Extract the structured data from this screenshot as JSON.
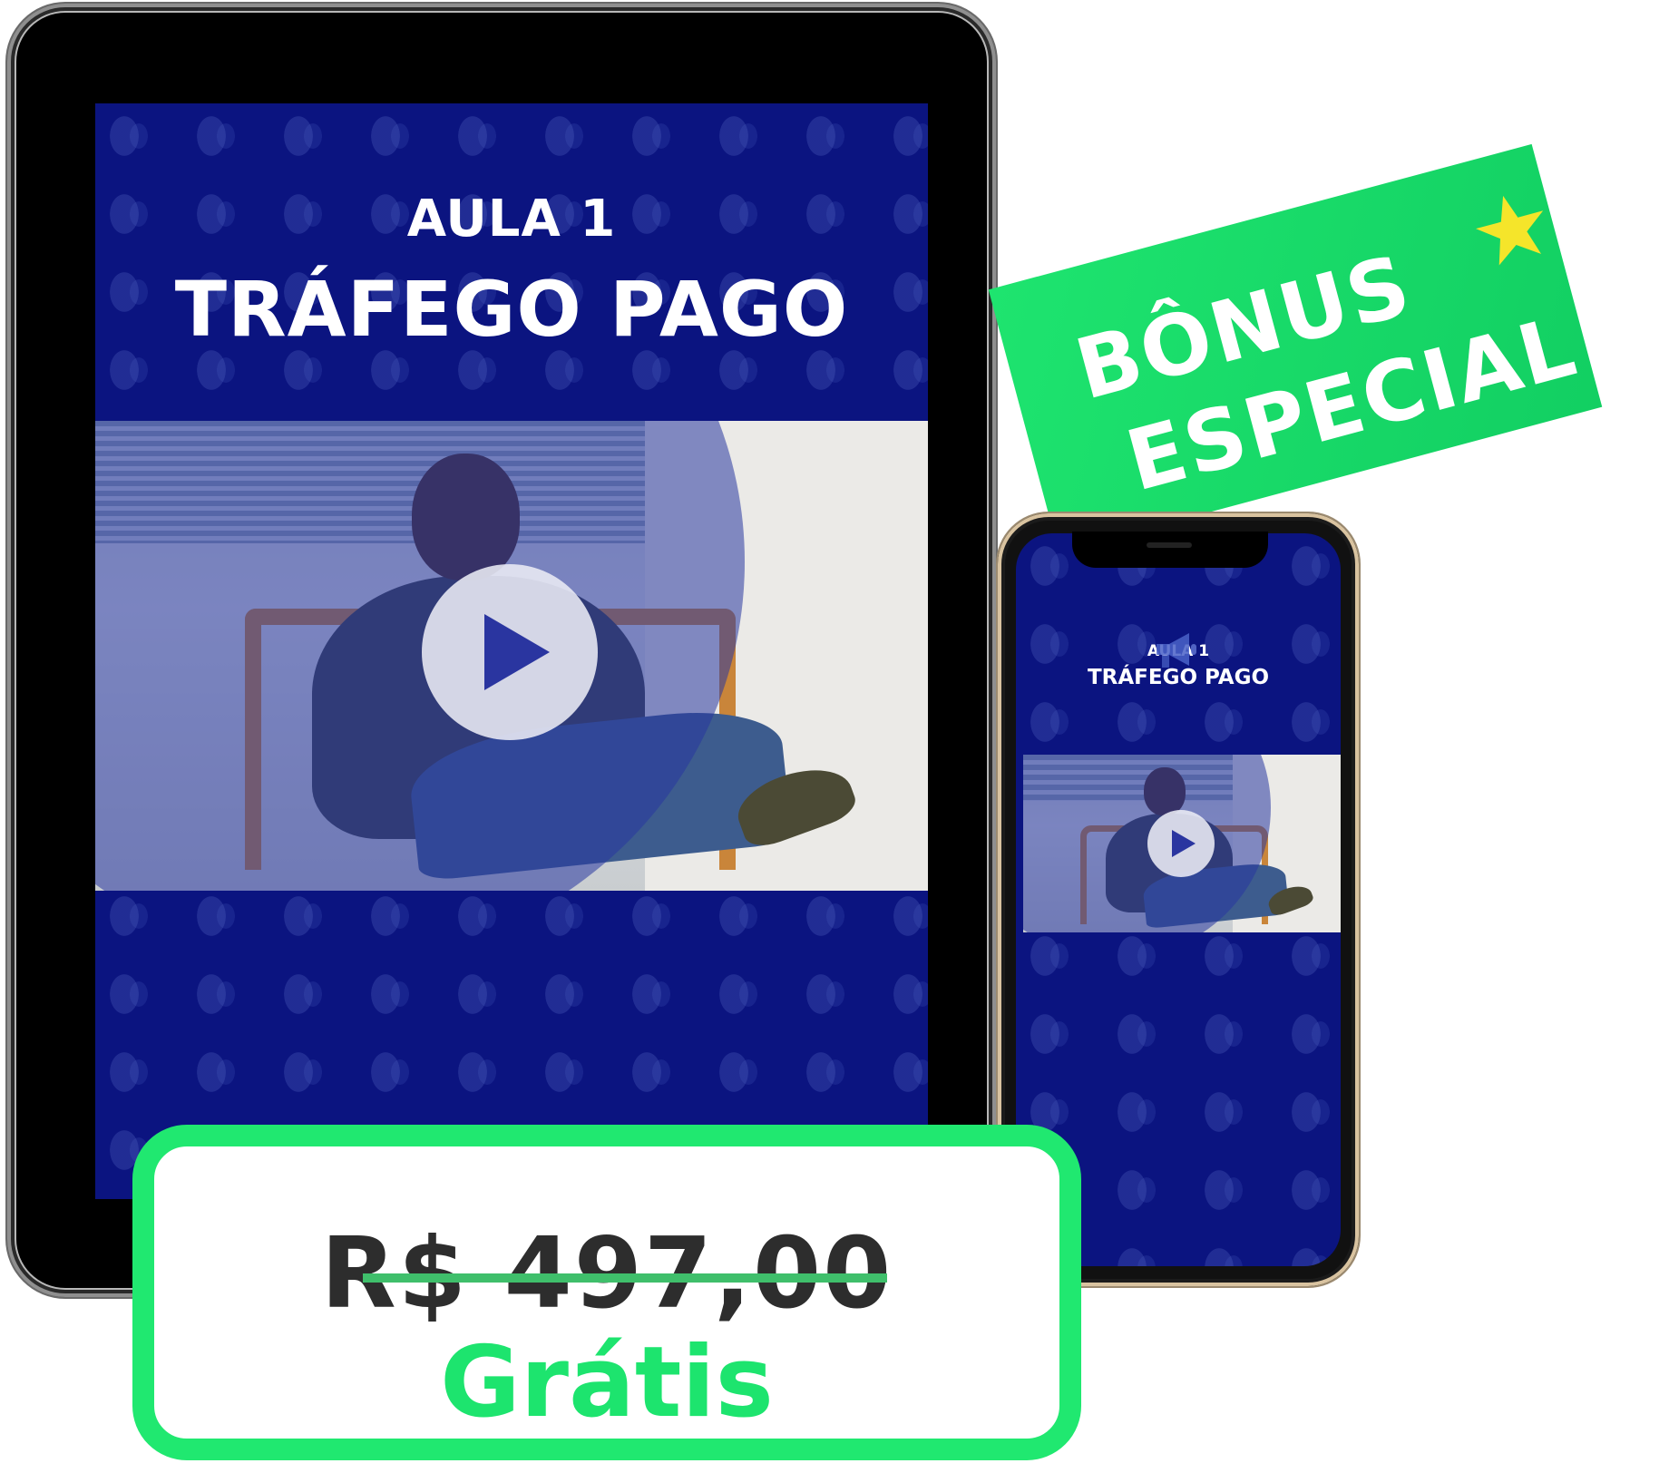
{
  "tablet": {
    "lesson_label": "AULA 1",
    "lesson_title": "TRÁFEGO PAGO"
  },
  "phone": {
    "lesson_label": "AULA 1",
    "lesson_title": "TRÁFEGO PAGO"
  },
  "bonus_banner": {
    "line1": "BÔNUS",
    "line2": "ESPECIAL"
  },
  "price": {
    "old_price": "R$ 497,00",
    "new_price": "Grátis"
  },
  "colors": {
    "brand_green": "#1de46e",
    "brand_blue": "#0b1480",
    "star_yellow": "#f5e52a"
  },
  "icons": [
    "play-icon",
    "megaphone-icon",
    "star-icon"
  ]
}
